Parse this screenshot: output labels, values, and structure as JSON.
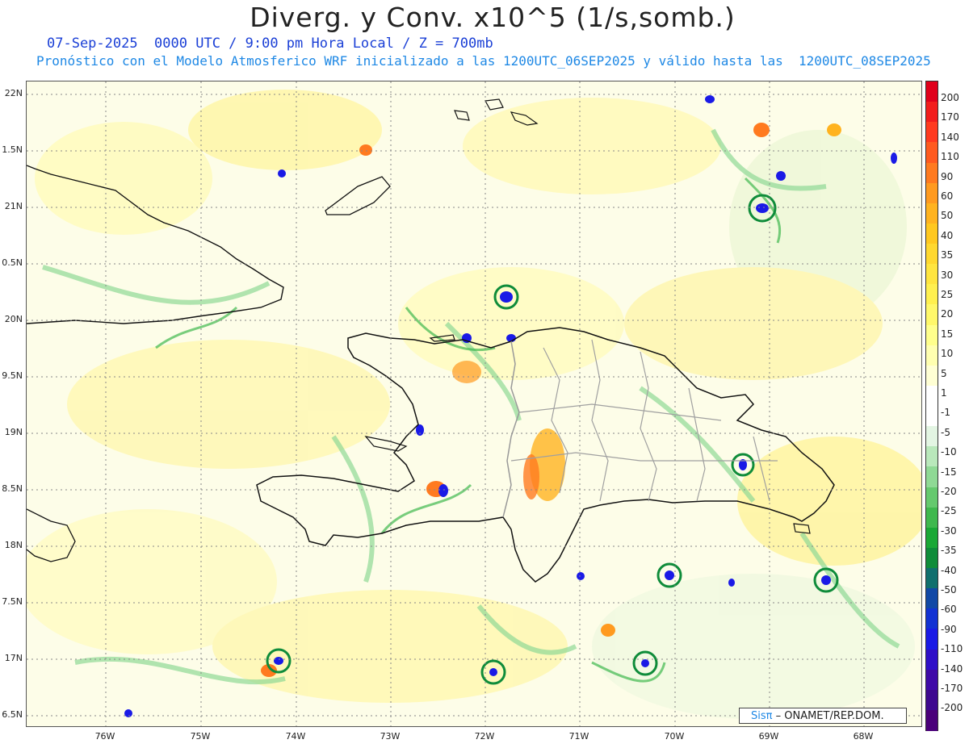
{
  "title": "Diverg. y Conv. x10^5 (1/s,somb.)",
  "subtitle1": "07-Sep-2025  0000 UTC / 9:00 pm Hora Local / Z = 700mb",
  "subtitle2": "Pronóstico con el Modelo Atmosferico WRF inicializado a las 1200UTC_06SEP2025 y válido hasta las  1200UTC_08SEP2025",
  "lat_labels": [
    "22N",
    "1.5N",
    "21N",
    "0.5N",
    "20N",
    "9.5N",
    "19N",
    "8.5N",
    "18N",
    "7.5N",
    "17N",
    "6.5N"
  ],
  "lon_labels": [
    "76W",
    "75W",
    "74W",
    "73W",
    "72W",
    "71W",
    "70W",
    "69W",
    "68W"
  ],
  "colorbar": {
    "labels": [
      "200",
      "170",
      "140",
      "110",
      "90",
      "60",
      "50",
      "40",
      "35",
      "30",
      "25",
      "20",
      "15",
      "10",
      "5",
      "1",
      "-1",
      "-5",
      "-10",
      "-15",
      "-20",
      "-25",
      "-30",
      "-35",
      "-40",
      "-50",
      "-60",
      "-90",
      "-110",
      "-140",
      "-170",
      "-200"
    ],
    "colors": [
      "#e0001b",
      "#f21d1d",
      "#ff3a1f",
      "#ff5a1f",
      "#ff7a1f",
      "#ff9a1f",
      "#ffb31f",
      "#ffc81f",
      "#ffd82f",
      "#ffe53f",
      "#fff04f",
      "#fff86a",
      "#ffff8c",
      "#ffffb0",
      "#ffffd4",
      "#ffffff",
      "#ffffff",
      "#e3f5e3",
      "#b9e8bb",
      "#8fd995",
      "#65c96e",
      "#3fb84e",
      "#1aa836",
      "#0f8c3a",
      "#106f6e",
      "#1148a6",
      "#1232d3",
      "#1a1ae6",
      "#2f0fc8",
      "#3f0aa8",
      "#3e0890",
      "#4a007a"
    ]
  },
  "credit": {
    "brand": "Sisπ",
    "text": "– ONAMET/REP.DOM."
  }
}
